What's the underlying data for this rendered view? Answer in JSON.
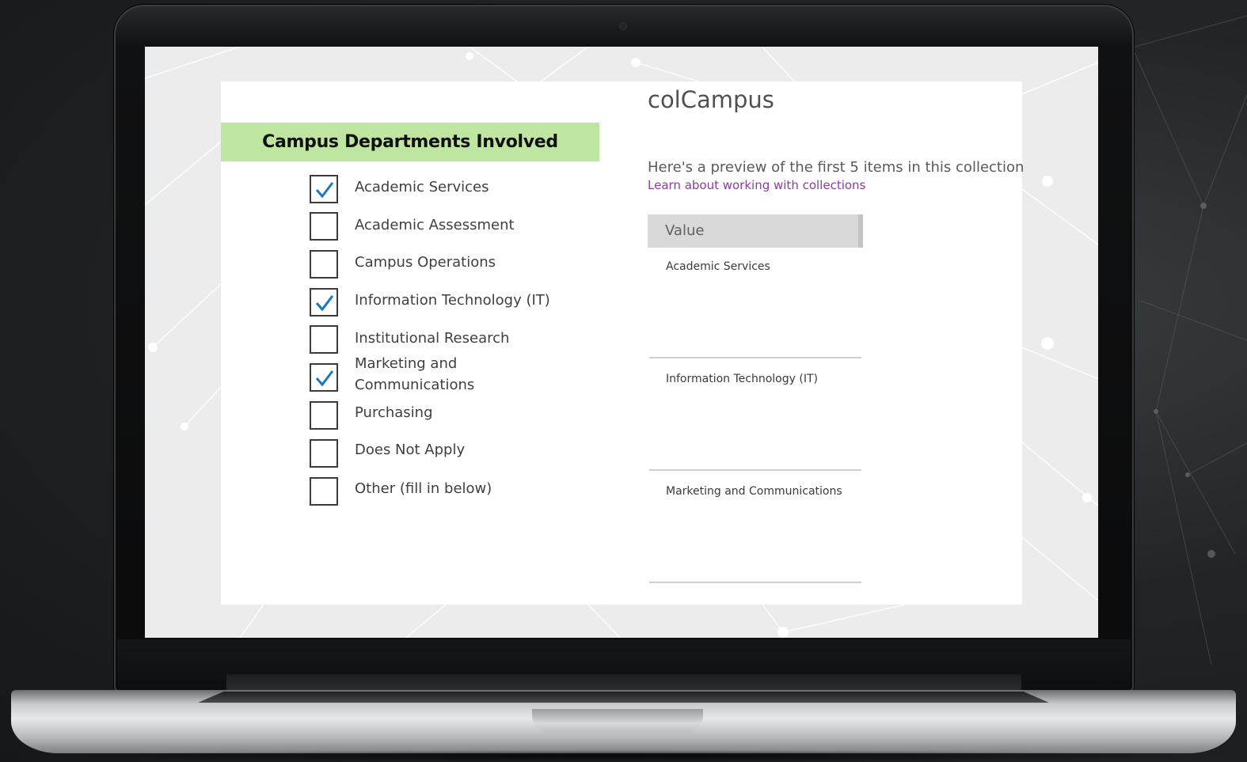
{
  "form": {
    "section_header": "Campus Departments Involved",
    "options": [
      {
        "label": "Academic Services",
        "checked": true
      },
      {
        "label": "Academic Assessment",
        "checked": false
      },
      {
        "label": "Campus Operations",
        "checked": false
      },
      {
        "label": "Information Technology (IT)",
        "checked": true
      },
      {
        "label": "Institutional Research",
        "checked": false
      },
      {
        "label": "Marketing and Communications",
        "checked": true
      },
      {
        "label": "Purchasing",
        "checked": false
      },
      {
        "label": "Does Not Apply",
        "checked": false
      },
      {
        "label": "Other (fill in below)",
        "checked": false
      }
    ]
  },
  "collection": {
    "name": "colCampus",
    "preview_text": "Here's a preview of the first 5 items in this collection",
    "learn_link": "Learn about working with collections",
    "column_header": "Value",
    "rows": [
      "Academic Services",
      "Information Technology (IT)",
      "Marketing and Communications"
    ]
  },
  "colors": {
    "header_green": "#bfe6a1",
    "check_blue": "#1a78c2",
    "link_purple": "#8a3d9a"
  },
  "icons": {
    "checkmark": "check-icon"
  }
}
